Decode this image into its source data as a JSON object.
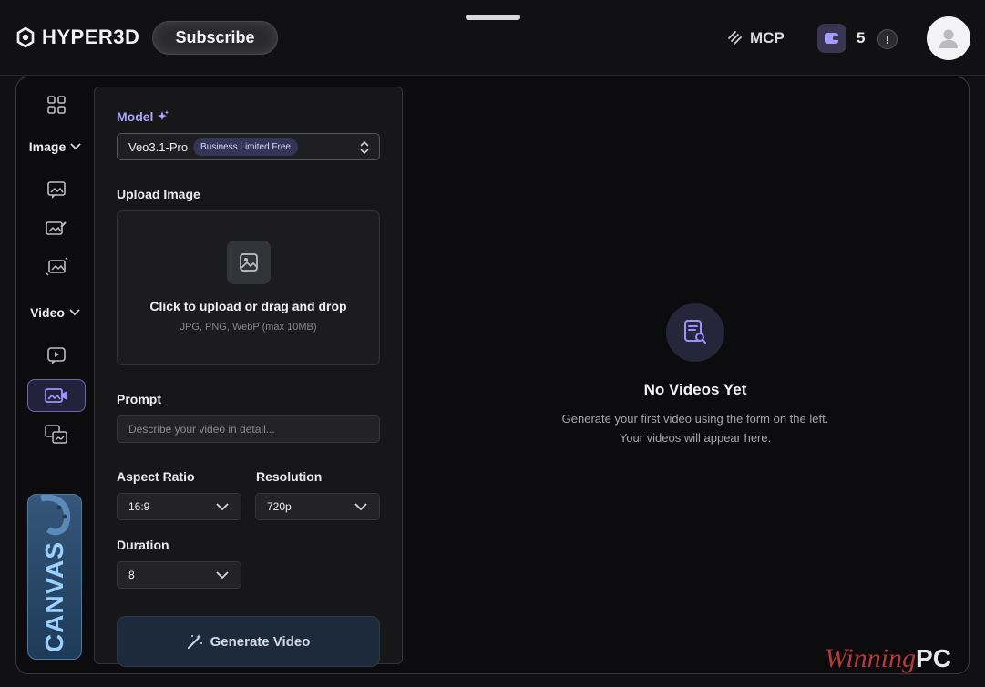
{
  "header": {
    "brand": "HYPER3D",
    "subscribe_label": "Subscribe",
    "mcp_label": "MCP",
    "credits": "5",
    "alert_glyph": "!"
  },
  "rail": {
    "image_section": "Image",
    "video_section": "Video",
    "canvas_label": "CANVAS"
  },
  "form": {
    "model_label": "Model",
    "model_value": "Veo3.1-Pro",
    "model_badge": "Business Limited Free",
    "upload_label": "Upload Image",
    "upload_title": "Click to upload or drag and drop",
    "upload_sub": "JPG, PNG, WebP (max 10MB)",
    "prompt_label": "Prompt",
    "prompt_placeholder": "Describe your video in detail...",
    "aspect_label": "Aspect Ratio",
    "aspect_value": "16:9",
    "resolution_label": "Resolution",
    "resolution_value": "720p",
    "duration_label": "Duration",
    "duration_value": "8",
    "generate_label": "Generate Video"
  },
  "empty_state": {
    "title": "No Videos Yet",
    "line1": "Generate your first video using the form on the left.",
    "line2": "Your videos will appear here."
  },
  "watermark": {
    "script": "Winning",
    "suffix": "PC"
  },
  "colors": {
    "accent": "#8b84ff",
    "active_bg": "#24223a",
    "canvas_blue": "#9bd0ff"
  }
}
